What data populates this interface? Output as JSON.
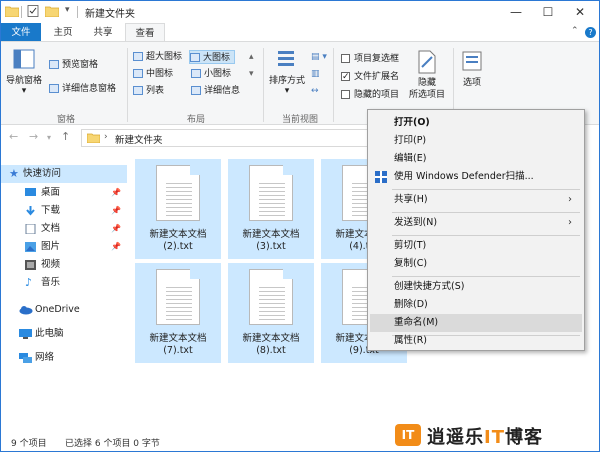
{
  "title": "新建文件夹",
  "window_controls": {
    "minimize": "—",
    "maximize": "☐",
    "close": "✕"
  },
  "tabs": [
    "文件",
    "主页",
    "共享",
    "查看"
  ],
  "ribbon": {
    "panes": {
      "nav_pane": "导航窗格",
      "preview": "预览窗格",
      "details": "详细信息窗格",
      "group_label": "窗格"
    },
    "layout": {
      "items": [
        "超大图标",
        "大图标",
        "中图标",
        "小图标",
        "列表",
        "详细信息"
      ],
      "selected": "大图标",
      "group_label": "布局"
    },
    "current_view": {
      "sort": "排序方式",
      "group_label": "当前视图"
    },
    "show_hide": {
      "checkboxes": [
        {
          "label": "项目复选框",
          "checked": false
        },
        {
          "label": "文件扩展名",
          "checked": true
        },
        {
          "label": "隐藏的项目",
          "checked": false
        }
      ],
      "hide_selected": "隐藏\n所选项目"
    },
    "options": "选项"
  },
  "address": {
    "path": "新建文件夹",
    "arrow": "›"
  },
  "nav": {
    "quick_access": "快速访问",
    "items": [
      "桌面",
      "下载",
      "文档",
      "图片",
      "视频",
      "音乐"
    ],
    "onedrive": "OneDrive",
    "this_pc": "此电脑",
    "network": "网络"
  },
  "files": [
    {
      "line1": "新建文本文档",
      "line2": "(2).txt"
    },
    {
      "line1": "新建文本文档",
      "line2": "(3).txt"
    },
    {
      "line1": "新建文本文档",
      "line2": "(4).txt"
    },
    {
      "line1": "新建文本文档",
      "line2": "(7).txt"
    },
    {
      "line1": "新建文本文档",
      "line2": "(8).txt"
    },
    {
      "line1": "新建文本文档",
      "line2": "(9).txt"
    }
  ],
  "context_menu": {
    "items": [
      "打开(O)",
      "打印(P)",
      "编辑(E)",
      "使用 Windows Defender扫描...",
      "共享(H)",
      "发送到(N)",
      "剪切(T)",
      "复制(C)",
      "创建快捷方式(S)",
      "删除(D)",
      "重命名(M)",
      "属性(R)"
    ],
    "hovered": "重命名(M)"
  },
  "status": {
    "count": "9 个项目",
    "selected": "已选择 6 个项目 0 字节"
  },
  "watermark": {
    "logo": "IT",
    "text_a": "逍遥乐",
    "text_b": "IT",
    "text_c": "博客"
  },
  "colors": {
    "accent": "#1979ca",
    "selection": "#cce8ff",
    "watermark": "#f28c18"
  }
}
